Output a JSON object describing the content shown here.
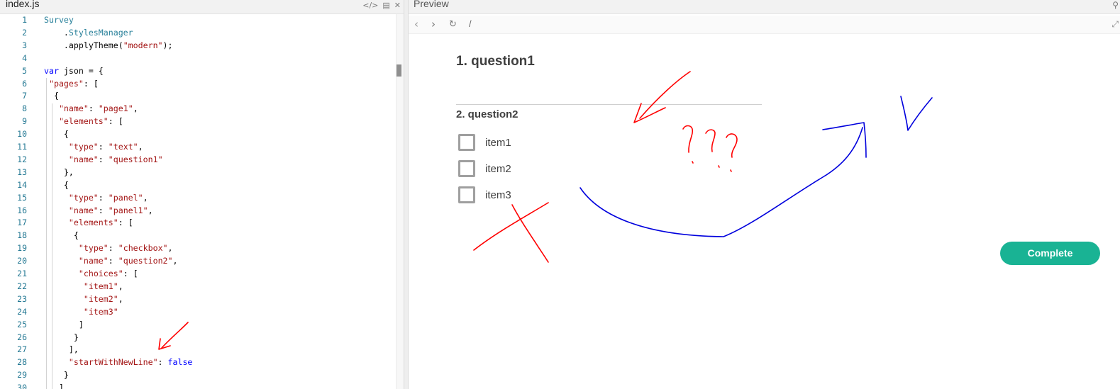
{
  "editor": {
    "title": "index.js",
    "icons": [
      "code-icon",
      "book-icon",
      "close-icon"
    ],
    "lines": [
      {
        "n": "1",
        "parts": [
          {
            "t": "Survey",
            "c": "obj"
          }
        ]
      },
      {
        "n": "2",
        "parts": [
          {
            "t": "    ",
            "c": "op"
          },
          {
            "t": ".",
            "c": "op"
          },
          {
            "t": "StylesManager",
            "c": "obj"
          }
        ]
      },
      {
        "n": "3",
        "parts": [
          {
            "t": "    .applyTheme(",
            "c": "op"
          },
          {
            "t": "\"modern\"",
            "c": "str"
          },
          {
            "t": ");",
            "c": "op"
          }
        ]
      },
      {
        "n": "4",
        "parts": []
      },
      {
        "n": "5",
        "parts": [
          {
            "t": "var",
            "c": "kw"
          },
          {
            "t": " json = {",
            "c": "op"
          }
        ]
      },
      {
        "n": "6",
        "parts": [
          {
            "t": " ",
            "c": "op"
          },
          {
            "t": "\"pages\"",
            "c": "str"
          },
          {
            "t": ": [",
            "c": "op"
          }
        ]
      },
      {
        "n": "7",
        "parts": [
          {
            "t": "  {",
            "c": "op"
          }
        ]
      },
      {
        "n": "8",
        "parts": [
          {
            "t": "   ",
            "c": "op"
          },
          {
            "t": "\"name\"",
            "c": "str"
          },
          {
            "t": ": ",
            "c": "op"
          },
          {
            "t": "\"page1\"",
            "c": "str"
          },
          {
            "t": ",",
            "c": "op"
          }
        ]
      },
      {
        "n": "9",
        "parts": [
          {
            "t": "   ",
            "c": "op"
          },
          {
            "t": "\"elements\"",
            "c": "str"
          },
          {
            "t": ": [",
            "c": "op"
          }
        ]
      },
      {
        "n": "10",
        "parts": [
          {
            "t": "    {",
            "c": "op"
          }
        ]
      },
      {
        "n": "11",
        "parts": [
          {
            "t": "     ",
            "c": "op"
          },
          {
            "t": "\"type\"",
            "c": "str"
          },
          {
            "t": ": ",
            "c": "op"
          },
          {
            "t": "\"text\"",
            "c": "str"
          },
          {
            "t": ",",
            "c": "op"
          }
        ]
      },
      {
        "n": "12",
        "parts": [
          {
            "t": "     ",
            "c": "op"
          },
          {
            "t": "\"name\"",
            "c": "str"
          },
          {
            "t": ": ",
            "c": "op"
          },
          {
            "t": "\"question1\"",
            "c": "str"
          }
        ]
      },
      {
        "n": "13",
        "parts": [
          {
            "t": "    },",
            "c": "op"
          }
        ]
      },
      {
        "n": "14",
        "parts": [
          {
            "t": "    {",
            "c": "op"
          }
        ]
      },
      {
        "n": "15",
        "parts": [
          {
            "t": "     ",
            "c": "op"
          },
          {
            "t": "\"type\"",
            "c": "str"
          },
          {
            "t": ": ",
            "c": "op"
          },
          {
            "t": "\"panel\"",
            "c": "str"
          },
          {
            "t": ",",
            "c": "op"
          }
        ]
      },
      {
        "n": "16",
        "parts": [
          {
            "t": "     ",
            "c": "op"
          },
          {
            "t": "\"name\"",
            "c": "str"
          },
          {
            "t": ": ",
            "c": "op"
          },
          {
            "t": "\"panel1\"",
            "c": "str"
          },
          {
            "t": ",",
            "c": "op"
          }
        ]
      },
      {
        "n": "17",
        "parts": [
          {
            "t": "     ",
            "c": "op"
          },
          {
            "t": "\"elements\"",
            "c": "str"
          },
          {
            "t": ": [",
            "c": "op"
          }
        ]
      },
      {
        "n": "18",
        "parts": [
          {
            "t": "      {",
            "c": "op"
          }
        ]
      },
      {
        "n": "19",
        "parts": [
          {
            "t": "       ",
            "c": "op"
          },
          {
            "t": "\"type\"",
            "c": "str"
          },
          {
            "t": ": ",
            "c": "op"
          },
          {
            "t": "\"checkbox\"",
            "c": "str"
          },
          {
            "t": ",",
            "c": "op"
          }
        ]
      },
      {
        "n": "20",
        "parts": [
          {
            "t": "       ",
            "c": "op"
          },
          {
            "t": "\"name\"",
            "c": "str"
          },
          {
            "t": ": ",
            "c": "op"
          },
          {
            "t": "\"question2\"",
            "c": "str"
          },
          {
            "t": ",",
            "c": "op"
          }
        ]
      },
      {
        "n": "21",
        "parts": [
          {
            "t": "       ",
            "c": "op"
          },
          {
            "t": "\"choices\"",
            "c": "str"
          },
          {
            "t": ": [",
            "c": "op"
          }
        ]
      },
      {
        "n": "22",
        "parts": [
          {
            "t": "        ",
            "c": "op"
          },
          {
            "t": "\"item1\"",
            "c": "str"
          },
          {
            "t": ",",
            "c": "op"
          }
        ]
      },
      {
        "n": "23",
        "parts": [
          {
            "t": "        ",
            "c": "op"
          },
          {
            "t": "\"item2\"",
            "c": "str"
          },
          {
            "t": ",",
            "c": "op"
          }
        ]
      },
      {
        "n": "24",
        "parts": [
          {
            "t": "        ",
            "c": "op"
          },
          {
            "t": "\"item3\"",
            "c": "str"
          }
        ]
      },
      {
        "n": "25",
        "parts": [
          {
            "t": "       ]",
            "c": "op"
          }
        ]
      },
      {
        "n": "26",
        "parts": [
          {
            "t": "      }",
            "c": "op"
          }
        ]
      },
      {
        "n": "27",
        "parts": [
          {
            "t": "     ],",
            "c": "op"
          }
        ]
      },
      {
        "n": "28",
        "parts": [
          {
            "t": "     ",
            "c": "op"
          },
          {
            "t": "\"startWithNewLine\"",
            "c": "str"
          },
          {
            "t": ": ",
            "c": "op"
          },
          {
            "t": "false",
            "c": "kw"
          }
        ]
      },
      {
        "n": "29",
        "parts": [
          {
            "t": "    }",
            "c": "op"
          }
        ]
      },
      {
        "n": "30",
        "parts": [
          {
            "t": "   ]",
            "c": "op"
          }
        ]
      }
    ]
  },
  "preview": {
    "title": "Preview",
    "url": "/",
    "nav_icons": [
      "back-icon",
      "forward-icon",
      "refresh-icon"
    ],
    "survey": {
      "q1_title": "1. question1",
      "q2_title": "2. question2",
      "choices": [
        "item1",
        "item2",
        "item3"
      ],
      "complete_label": "Complete"
    }
  },
  "colors": {
    "accent": "#19b394",
    "annotation_red": "#ff0000",
    "annotation_blue": "#0000dd"
  }
}
